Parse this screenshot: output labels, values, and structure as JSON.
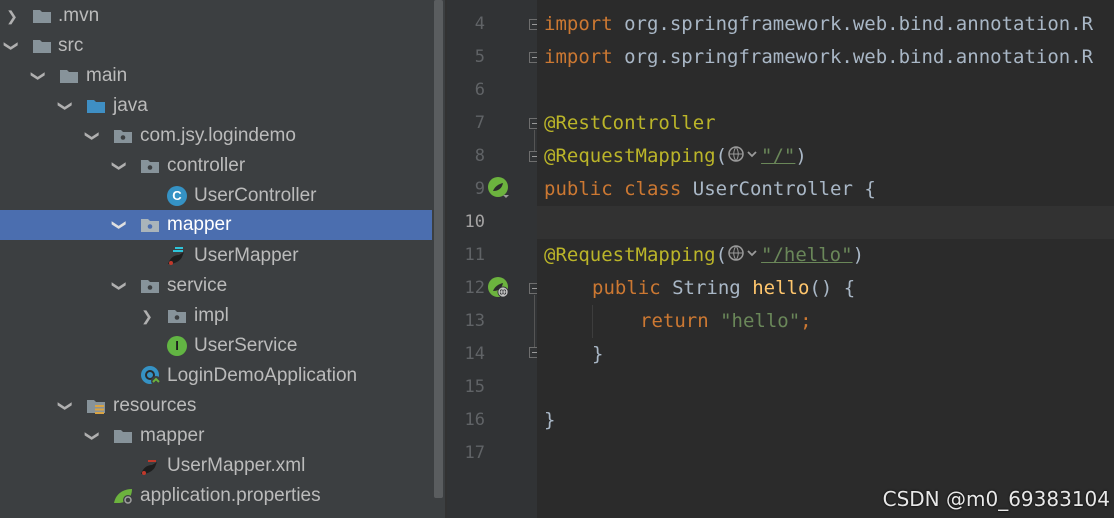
{
  "tree": {
    "items": [
      {
        "label": ".mvn"
      },
      {
        "label": "src"
      },
      {
        "label": "main"
      },
      {
        "label": "java"
      },
      {
        "label": "com.jsy.logindemo"
      },
      {
        "label": "controller"
      },
      {
        "label": "UserController"
      },
      {
        "label": "mapper"
      },
      {
        "label": "UserMapper"
      },
      {
        "label": "service"
      },
      {
        "label": "impl"
      },
      {
        "label": "UserService"
      },
      {
        "label": "LoginDemoApplication"
      },
      {
        "label": "resources"
      },
      {
        "label": "mapper"
      },
      {
        "label": "UserMapper.xml"
      },
      {
        "label": "application.properties"
      }
    ],
    "class_badge": "C",
    "interface_badge": "I"
  },
  "editor": {
    "line_numbers": [
      "4",
      "5",
      "6",
      "7",
      "8",
      "9",
      "10",
      "11",
      "12",
      "13",
      "14",
      "15",
      "16",
      "17"
    ],
    "current_line": "10",
    "lines": {
      "l4": {
        "kw": "import",
        "rest": " org.springframework.web.bind.annotation.R"
      },
      "l5": {
        "kw": "import",
        "rest": " org.springframework.web.bind.annotation.R"
      },
      "l7": {
        "ann": "@RestController"
      },
      "l8": {
        "ann": "@RequestMapping",
        "open": "(",
        "str": "\"/\"",
        "close": ")"
      },
      "l9": {
        "kw1": "public",
        "kw2": "class",
        "name": "UserController",
        "brace": "{"
      },
      "l11": {
        "ann": "@RequestMapping",
        "open": "(",
        "str": "\"/hello\"",
        "close": ")"
      },
      "l12": {
        "kw": "public",
        "type": "String",
        "fn": "hello",
        "rest": "() {"
      },
      "l13": {
        "kw": "return",
        "str": "\"hello\"",
        "semi": ";"
      },
      "l14": {
        "brace": "}"
      },
      "l16": {
        "brace": "}"
      }
    }
  },
  "watermark": "CSDN @m0_69383104",
  "colors": {
    "keyword": "#cc7832",
    "annotation": "#bbb529",
    "string": "#6a8759",
    "function": "#ffc66d",
    "selection": "#4b6eaf",
    "spring_green": "#6cb33e"
  }
}
